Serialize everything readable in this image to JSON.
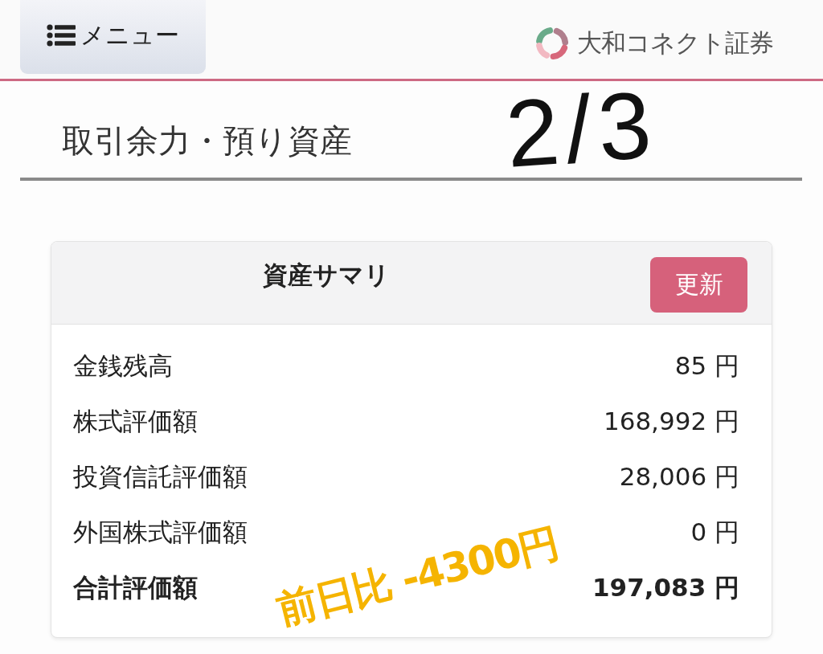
{
  "header": {
    "menu_button": {
      "label": "メニュー"
    },
    "brand": {
      "name": "大和コネクト証券"
    }
  },
  "page_title": "取引余力・預り資産",
  "summary": {
    "title": "資産サマリ",
    "refresh_button": "更新",
    "rows": [
      {
        "kind": "item",
        "label": "金銭残高",
        "value": "85 円"
      },
      {
        "kind": "item",
        "label": "株式評価額",
        "value": "168,992 円"
      },
      {
        "kind": "item",
        "label": "投資信託評価額",
        "value": "28,006 円"
      },
      {
        "kind": "item",
        "label": "外国株式評価額",
        "value": "0 円"
      },
      {
        "kind": "total",
        "label": "合計評価額",
        "value": "197,083 円"
      }
    ]
  },
  "annotations": [
    {
      "text": "2/3",
      "color": "#111111"
    },
    {
      "text": "前日比 -4300円",
      "color": "#f5b400"
    }
  ]
}
